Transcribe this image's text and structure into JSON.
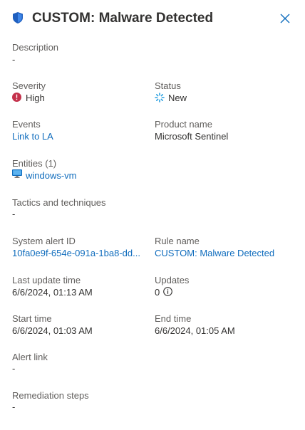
{
  "header": {
    "title": "CUSTOM: Malware Detected",
    "icons": {
      "title_icon": "shield-icon",
      "close": "close-icon"
    }
  },
  "fields": {
    "description": {
      "label": "Description",
      "value": "-"
    },
    "severity": {
      "label": "Severity",
      "value": "High",
      "icon": "alert-circle-icon",
      "color": "#c4314b"
    },
    "status": {
      "label": "Status",
      "value": "New",
      "icon": "new-status-icon",
      "color": "#2aa0e0"
    },
    "events": {
      "label": "Events",
      "value": "Link to LA"
    },
    "product_name": {
      "label": "Product name",
      "value": "Microsoft Sentinel"
    },
    "entities": {
      "label": "Entities (1)",
      "value": "windows-vm",
      "icon": "virtual-machine-icon"
    },
    "tactics": {
      "label": "Tactics and techniques",
      "value": "-"
    },
    "system_alert_id": {
      "label": "System alert ID",
      "value": "10fa0e9f-654e-091a-1ba8-dd..."
    },
    "rule_name": {
      "label": "Rule name",
      "value": "CUSTOM: Malware Detected"
    },
    "last_update_time": {
      "label": "Last update time",
      "value": "6/6/2024, 01:13 AM"
    },
    "updates": {
      "label": "Updates",
      "value": "0",
      "icon": "info-icon"
    },
    "start_time": {
      "label": "Start time",
      "value": "6/6/2024, 01:03 AM"
    },
    "end_time": {
      "label": "End time",
      "value": "6/6/2024, 01:05 AM"
    },
    "alert_link": {
      "label": "Alert link",
      "value": "-"
    },
    "remediation_steps": {
      "label": "Remediation steps",
      "value": "-"
    }
  },
  "colors": {
    "link": "#0f6cbd",
    "label": "#605e5c",
    "text": "#323130",
    "accent_blue": "#0f6cbd"
  }
}
